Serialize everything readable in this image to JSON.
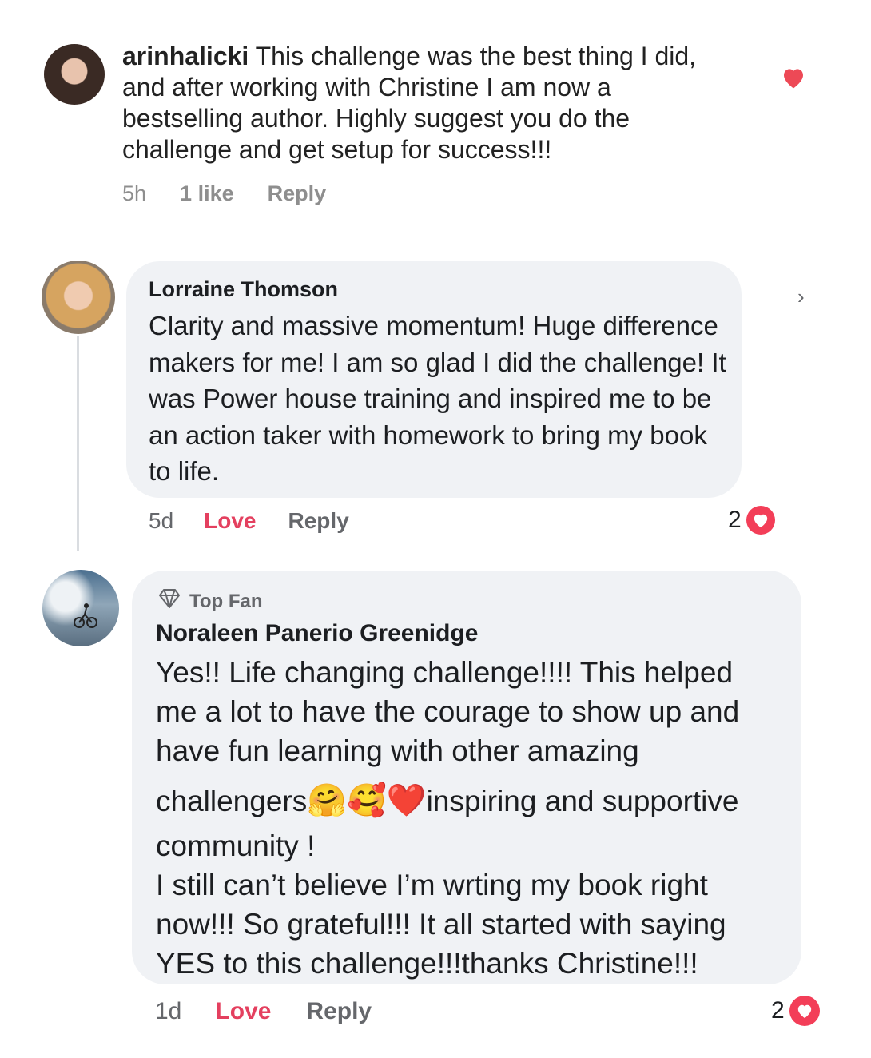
{
  "comment1": {
    "username": "arinhalicki",
    "text": "This challenge was the best thing I did, and after working with Christine I am now a bestselling author. Highly suggest you do the challenge and get setup for success!!!",
    "time": "5h",
    "likes": "1 like",
    "reply": "Reply",
    "liked_color": "#ed4956"
  },
  "comment2": {
    "name": "Lorraine Thomson",
    "text": "Clarity and massive momentum! Huge difference makers for me! I am so glad I did the challenge! It was Power house training and inspired me to be an action taker with homework to bring my book to life.",
    "time": "5d",
    "love": "Love",
    "reply": "Reply",
    "reaction_count": "2",
    "chevron": "›"
  },
  "comment3": {
    "badge": "Top Fan",
    "name": "Noraleen Panerio Greenidge",
    "text_lines": [
      "Yes!! Life changing challenge!!!! This helped",
      "me a lot to have the courage to show up and",
      "have fun learning with other amazing",
      "challengers",
      "inspiring and supportive",
      "community !",
      "I still can’t believe I’m wrting my book right",
      "now!!!  So grateful!!! It all started with saying",
      "YES to this challenge!!!thanks Christine!!!"
    ],
    "emojis": [
      "🤗",
      "🥰",
      "❤️"
    ],
    "time": "1d",
    "love": "Love",
    "reply": "Reply",
    "reaction_count": "2"
  },
  "colors": {
    "bubble": "#f0f2f5",
    "love": "#e4405f",
    "reaction_heart": "#f33e58"
  }
}
